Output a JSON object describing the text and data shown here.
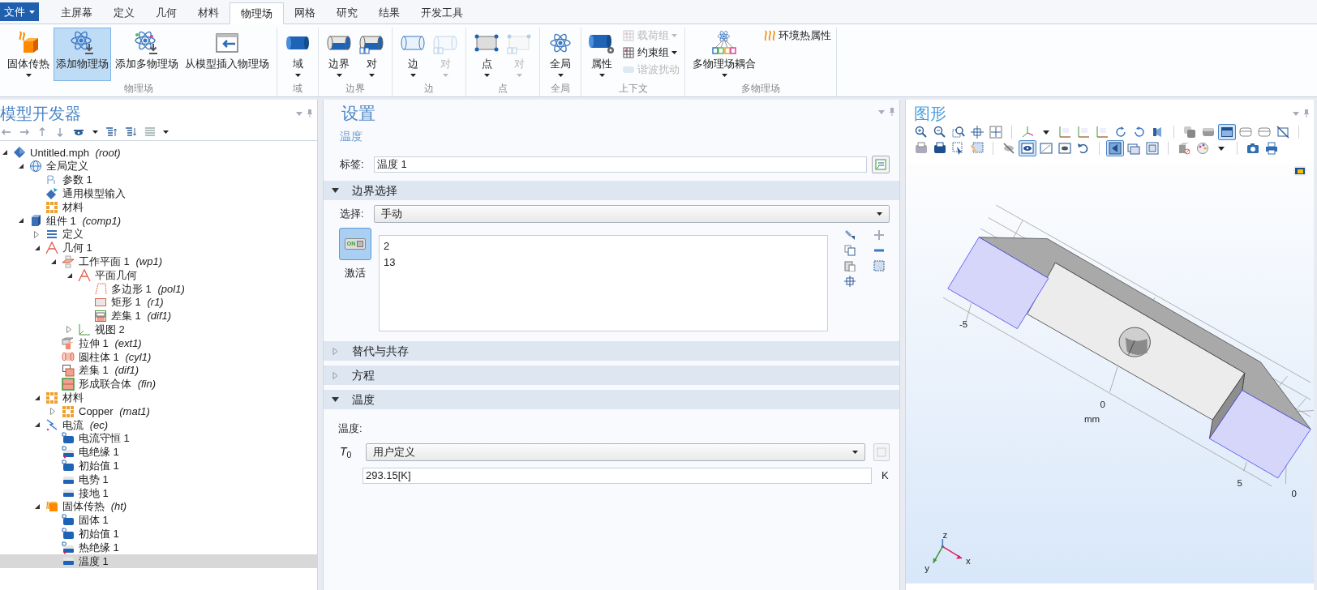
{
  "file_menu": "文件",
  "tabs": [
    {
      "label": "主屏幕",
      "selected": false
    },
    {
      "label": "定义",
      "selected": false
    },
    {
      "label": "几何",
      "selected": false
    },
    {
      "label": "材料",
      "selected": false
    },
    {
      "label": "物理场",
      "selected": true
    },
    {
      "label": "网格",
      "selected": false
    },
    {
      "label": "研究",
      "selected": false
    },
    {
      "label": "结果",
      "selected": false
    },
    {
      "label": "开发工具",
      "selected": false
    }
  ],
  "ribbon_groups": [
    {
      "label": "物理场",
      "items": [
        {
          "label": "固体传热",
          "kind": "large",
          "dropdown": true,
          "disabled": false,
          "selected": false
        },
        {
          "label": "添加物理场",
          "kind": "large",
          "dropdown": false,
          "disabled": false,
          "selected": true
        },
        {
          "label": "添加多物理场",
          "kind": "large",
          "dropdown": false,
          "disabled": false,
          "selected": false
        },
        {
          "label": "从模型插入物理场",
          "kind": "large",
          "dropdown": false,
          "disabled": false,
          "selected": false
        }
      ]
    },
    {
      "label": "域",
      "items": [
        {
          "label": "域",
          "kind": "large",
          "dropdown": true,
          "disabled": false
        }
      ]
    },
    {
      "label": "边界",
      "items": [
        {
          "label": "边界",
          "kind": "large",
          "dropdown": true,
          "disabled": false
        },
        {
          "label": "对",
          "kind": "large",
          "dropdown": true,
          "disabled": false
        }
      ]
    },
    {
      "label": "边",
      "items": [
        {
          "label": "边",
          "kind": "large",
          "dropdown": true,
          "disabled": false
        },
        {
          "label": "对",
          "kind": "large",
          "dropdown": true,
          "disabled": true
        }
      ]
    },
    {
      "label": "点",
      "items": [
        {
          "label": "点",
          "kind": "large",
          "dropdown": true,
          "disabled": false
        },
        {
          "label": "对",
          "kind": "large",
          "dropdown": true,
          "disabled": true
        }
      ]
    },
    {
      "label": "全局",
      "items": [
        {
          "label": "全局",
          "kind": "large",
          "dropdown": true,
          "disabled": false
        }
      ]
    },
    {
      "label": "上下文",
      "items": [
        {
          "label": "属性",
          "kind": "large",
          "dropdown": true,
          "disabled": false
        },
        {
          "label": "载荷组",
          "kind": "small",
          "dropdown": true,
          "disabled": true
        },
        {
          "label": "约束组",
          "kind": "small",
          "dropdown": true,
          "disabled": false
        },
        {
          "label": "谐波扰动",
          "kind": "small",
          "dropdown": false,
          "disabled": true
        }
      ]
    },
    {
      "label": "多物理场",
      "items": [
        {
          "label": "多物理场耦合",
          "kind": "large",
          "dropdown": true,
          "disabled": false
        },
        {
          "label": "环境热属性",
          "kind": "small",
          "dropdown": false,
          "disabled": false
        }
      ]
    }
  ],
  "model_builder": {
    "title": "模型开发器",
    "tree": [
      {
        "label": "Untitled.mph",
        "tag": "(root)",
        "kind": "root",
        "expanded": true,
        "selected": false,
        "children": [
          {
            "label": "全局定义",
            "kind": "globe",
            "expanded": true,
            "selected": false,
            "children": [
              {
                "label": "参数 1",
                "kind": "param",
                "selected": false
              },
              {
                "label": "通用模型输入",
                "kind": "import",
                "selected": false
              },
              {
                "label": "材料",
                "kind": "material",
                "selected": false
              }
            ]
          },
          {
            "label": "组件 1",
            "tag": "(comp1)",
            "kind": "component",
            "expanded": true,
            "selected": false,
            "children": [
              {
                "label": "定义",
                "kind": "definitions",
                "expanded": false,
                "selected": false
              },
              {
                "label": "几何 1",
                "kind": "geometry",
                "expanded": true,
                "selected": false,
                "children": [
                  {
                    "label": "工作平面 1",
                    "tag": "(wp1)",
                    "kind": "workplane",
                    "expanded": true,
                    "selected": false,
                    "children": [
                      {
                        "label": "平面几何",
                        "kind": "geometry",
                        "expanded": true,
                        "selected": false,
                        "children": [
                          {
                            "label": "多边形 1",
                            "tag": "(pol1)",
                            "kind": "polygon",
                            "selected": false
                          },
                          {
                            "label": "矩形 1",
                            "tag": "(r1)",
                            "kind": "rectangle",
                            "selected": false
                          },
                          {
                            "label": "差集 1",
                            "tag": "(dif1)",
                            "kind": "difference",
                            "selected": false
                          }
                        ]
                      },
                      {
                        "label": "视图 2",
                        "kind": "view",
                        "expanded": false,
                        "selected": false
                      }
                    ]
                  },
                  {
                    "label": "拉伸 1",
                    "tag": "(ext1)",
                    "kind": "extrude",
                    "selected": false
                  },
                  {
                    "label": "圆柱体 1",
                    "tag": "(cyl1)",
                    "kind": "cylinder",
                    "selected": false
                  },
                  {
                    "label": "差集 1",
                    "tag": "(dif1)",
                    "kind": "difference2",
                    "selected": false
                  },
                  {
                    "label": "形成联合体",
                    "tag": "(fin)",
                    "kind": "union",
                    "selected": false
                  }
                ]
              },
              {
                "label": "材料",
                "kind": "material",
                "expanded": true,
                "selected": false,
                "children": [
                  {
                    "label": "Copper",
                    "tag": "(mat1)",
                    "kind": "material",
                    "expanded": false,
                    "selected": false
                  }
                ]
              },
              {
                "label": "电流",
                "tag": "(ec)",
                "kind": "current",
                "expanded": true,
                "selected": false,
                "children": [
                  {
                    "label": "电流守恒 1",
                    "kind": "domain",
                    "selected": false
                  },
                  {
                    "label": "电绝缘 1",
                    "kind": "boundary_d",
                    "selected": false
                  },
                  {
                    "label": "初始值 1",
                    "kind": "domain",
                    "selected": false
                  },
                  {
                    "label": "电势 1",
                    "kind": "boundary",
                    "selected": false
                  },
                  {
                    "label": "接地 1",
                    "kind": "boundary",
                    "selected": false
                  }
                ]
              },
              {
                "label": "固体传热",
                "tag": "(ht)",
                "kind": "heat",
                "expanded": true,
                "selected": false,
                "children": [
                  {
                    "label": "固体 1",
                    "kind": "domain",
                    "selected": false
                  },
                  {
                    "label": "初始值 1",
                    "kind": "domain",
                    "selected": false
                  },
                  {
                    "label": "热绝缘 1",
                    "kind": "boundary_d",
                    "selected": false
                  },
                  {
                    "label": "温度 1",
                    "kind": "boundary",
                    "selected": true
                  }
                ]
              }
            ]
          }
        ]
      }
    ]
  },
  "settings": {
    "title": "设置",
    "subtitle": "温度",
    "label_field": {
      "label": "标签:",
      "value": "温度 1"
    },
    "sections": [
      {
        "title": "边界选择",
        "expanded": true,
        "kind": "selection",
        "selection_label": "选择:",
        "selection_value": "手动",
        "toggle_text": "ON",
        "active_label": "激活",
        "active": true,
        "items": [
          "2",
          "13"
        ]
      },
      {
        "title": "替代与共存",
        "expanded": false
      },
      {
        "title": "方程",
        "expanded": false
      },
      {
        "title": "温度",
        "expanded": true,
        "kind": "temperature",
        "heading": "温度:",
        "symbol": "*T*$_{0}$",
        "mode": "用户定义",
        "value": "293.15[K]",
        "unit": "K"
      }
    ]
  },
  "graphics": {
    "title": "图形",
    "toolbar_rows": [
      [
        {
          "selected": false
        },
        {
          "selected": false
        },
        {
          "selected": false
        },
        {
          "selected": false
        },
        {
          "selected": false
        },
        {
          "selected": false
        },
        {
          "selected": false
        },
        {
          "selected": false
        },
        {
          "selected": false
        },
        {
          "selected": false
        },
        {
          "selected": false
        },
        {
          "selected": false
        },
        {
          "selected": false
        },
        {
          "selected": false
        },
        {
          "selected": false
        },
        {
          "selected": true
        },
        {
          "selected": false
        },
        {
          "selected": false
        },
        {
          "selected": false
        }
      ],
      [
        {
          "selected": false
        },
        {
          "selected": false
        },
        {
          "selected": false
        },
        {
          "selected": false
        },
        {
          "selected": false
        },
        {
          "selected": true
        },
        {
          "selected": false
        },
        {
          "selected": false
        },
        {
          "selected": false
        },
        {
          "selected": true
        },
        {
          "selected": false
        },
        {
          "selected": false
        },
        {
          "selected": false
        },
        {
          "selected": false
        },
        {
          "selected": false
        },
        {
          "selected": false
        },
        {
          "selected": false
        }
      ]
    ],
    "axis_labels": [
      "-5",
      "0",
      "mm",
      "5",
      "0"
    ],
    "triad_labels": [
      "z",
      "x",
      "y"
    ]
  }
}
